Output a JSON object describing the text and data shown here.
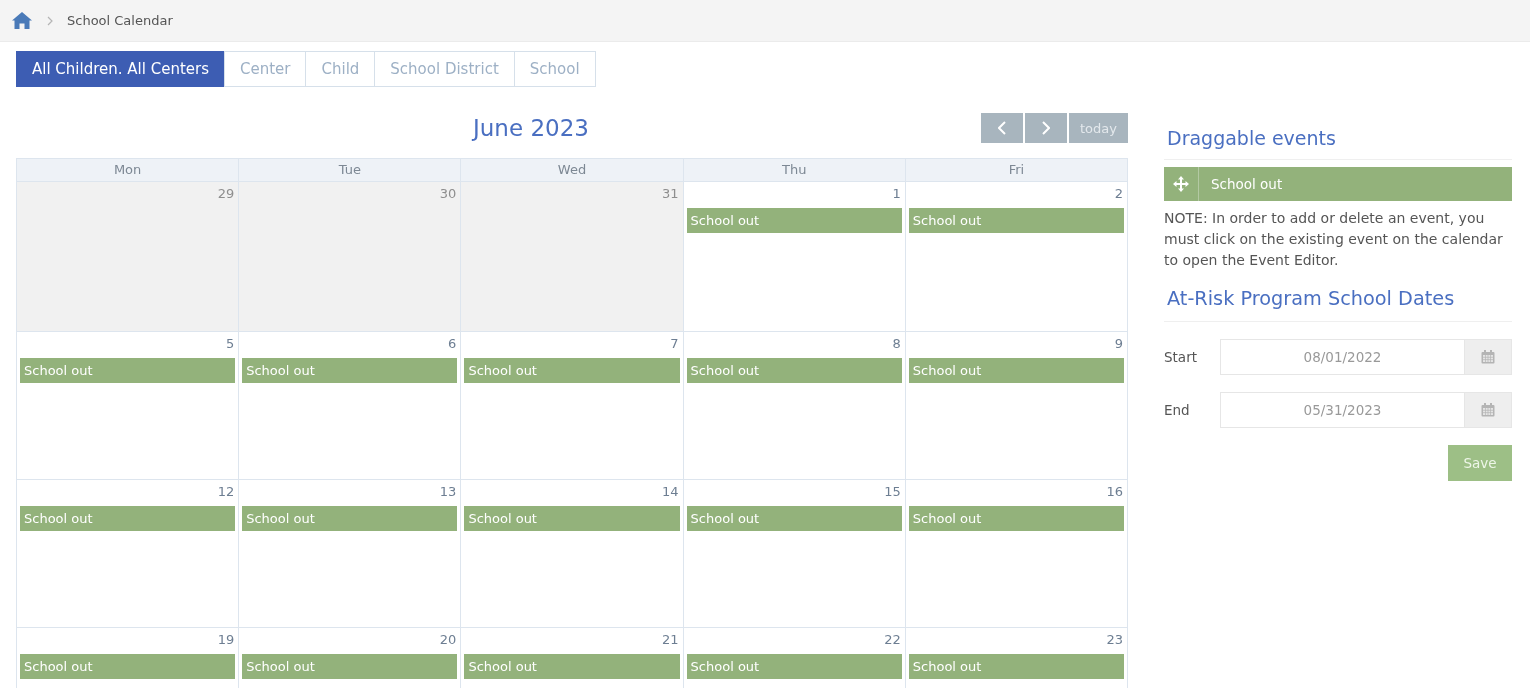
{
  "breadcrumb": {
    "current": "School Calendar"
  },
  "filter_tabs": [
    {
      "label": "All Children. All Centers",
      "selected": true
    },
    {
      "label": "Center",
      "selected": false
    },
    {
      "label": "Child",
      "selected": false
    },
    {
      "label": "School District",
      "selected": false
    },
    {
      "label": "School",
      "selected": false
    }
  ],
  "calendar": {
    "title": "June 2023",
    "nav_buttons": [
      {
        "kind": "prev"
      },
      {
        "kind": "next"
      },
      {
        "kind": "today",
        "label": "today"
      }
    ],
    "weekdays": [
      "Mon",
      "Tue",
      "Wed",
      "Thu",
      "Fri"
    ],
    "weeks": [
      {
        "days": [
          {
            "day": "29",
            "other_month": true
          },
          {
            "day": "30",
            "other_month": true
          },
          {
            "day": "31",
            "other_month": true
          },
          {
            "day": "1",
            "other_month": false,
            "events": [
              {
                "title": "School out"
              }
            ]
          },
          {
            "day": "2",
            "other_month": false,
            "events": [
              {
                "title": "School out"
              }
            ]
          }
        ]
      },
      {
        "days": [
          {
            "day": "5",
            "other_month": false,
            "events": [
              {
                "title": "School out"
              }
            ]
          },
          {
            "day": "6",
            "other_month": false,
            "events": [
              {
                "title": "School out"
              }
            ]
          },
          {
            "day": "7",
            "other_month": false,
            "events": [
              {
                "title": "School out"
              }
            ]
          },
          {
            "day": "8",
            "other_month": false,
            "events": [
              {
                "title": "School out"
              }
            ]
          },
          {
            "day": "9",
            "other_month": false,
            "events": [
              {
                "title": "School out"
              }
            ]
          }
        ]
      },
      {
        "days": [
          {
            "day": "12",
            "other_month": false,
            "events": [
              {
                "title": "School out"
              }
            ]
          },
          {
            "day": "13",
            "other_month": false,
            "events": [
              {
                "title": "School out"
              }
            ]
          },
          {
            "day": "14",
            "other_month": false,
            "events": [
              {
                "title": "School out"
              }
            ]
          },
          {
            "day": "15",
            "other_month": false,
            "events": [
              {
                "title": "School out"
              }
            ]
          },
          {
            "day": "16",
            "other_month": false,
            "events": [
              {
                "title": "School out"
              }
            ]
          }
        ]
      },
      {
        "days": [
          {
            "day": "19",
            "other_month": false,
            "events": [
              {
                "title": "School out"
              }
            ]
          },
          {
            "day": "20",
            "other_month": false,
            "events": [
              {
                "title": "School out"
              }
            ]
          },
          {
            "day": "21",
            "other_month": false,
            "events": [
              {
                "title": "School out"
              }
            ]
          },
          {
            "day": "22",
            "other_month": false,
            "events": [
              {
                "title": "School out"
              }
            ]
          },
          {
            "day": "23",
            "other_month": false,
            "events": [
              {
                "title": "School out"
              }
            ]
          }
        ]
      }
    ]
  },
  "draggable_events": {
    "title": "Draggable events",
    "events": [
      {
        "label": "School out"
      }
    ],
    "note": "NOTE: In order to add or delete an event, you must click on the existing event on the calendar to open the Event Editor."
  },
  "school_dates": {
    "title": "At-Risk Program School Dates",
    "fields": [
      {
        "label": "Start",
        "value": "08/01/2022"
      },
      {
        "label": "End",
        "value": "05/31/2023"
      }
    ],
    "save_label": "Save"
  }
}
